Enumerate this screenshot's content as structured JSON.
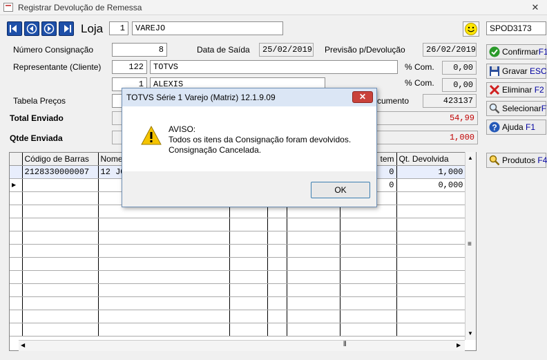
{
  "window": {
    "title": "Registrar Devolução de Remessa",
    "close_glyph": "✕"
  },
  "header": {
    "loja_label": "Loja",
    "loja_code": "1",
    "loja_name": "VAREJO",
    "terminal": "SPOD3173"
  },
  "form": {
    "num_consig_label": "Número Consignação",
    "num_consig": "8",
    "data_saida_label": "Data de Saída",
    "data_saida": "25/02/2019",
    "previsao_label": "Previsão p/Devolução",
    "previsao": "26/02/2019",
    "representante_label": "Representante (Cliente)",
    "rep_code": "122",
    "rep_name": "TOTVS",
    "com_label": "% Com.",
    "com1": "0,00",
    "rep2_code": "1",
    "rep2_name": "ALEXIS",
    "com2_label": "% Com.",
    "com2": "0,00",
    "tabela_label": "Tabela Preços",
    "documento_label": "cumento",
    "documento": "423137",
    "total_label": "Total Enviado",
    "total": "54,99",
    "qtde_label": "Qtde Enviada",
    "qtde": "1,000"
  },
  "buttons": {
    "confirmar": "Confirmar",
    "confirmar_key": "F10",
    "gravar": "Gravar",
    "gravar_key": "ESC",
    "eliminar": "Eliminar",
    "eliminar_key": "F2",
    "selecionar": "Selecionar",
    "selecionar_key": "F7",
    "ajuda": "Ajuda",
    "ajuda_key": "F1",
    "produtos": "Produtos",
    "produtos_key": "F4"
  },
  "grid": {
    "columns": [
      "Código de Barras",
      "Nome",
      "tem",
      "Qt. Devolvida"
    ],
    "rows": [
      {
        "codigo": "2128330000007",
        "nome": "12 JO",
        "item": "0",
        "qt_dev": "1,000"
      },
      {
        "codigo": "",
        "nome": "",
        "item": "0",
        "qt_dev": "0,000"
      }
    ]
  },
  "dialog": {
    "title": "TOTVS Série 1 Varejo (Matriz) 12.1.9.09",
    "close_glyph": "✕",
    "heading": "AVISO:",
    "line1": "Todos os itens da Consignação foram devolvidos.",
    "line2": "Consignação Cancelada.",
    "ok": "OK"
  },
  "colors": {
    "accent": "#1d4fa8",
    "red_value": "#c00000",
    "dialog_title": "#dbe6f5"
  }
}
